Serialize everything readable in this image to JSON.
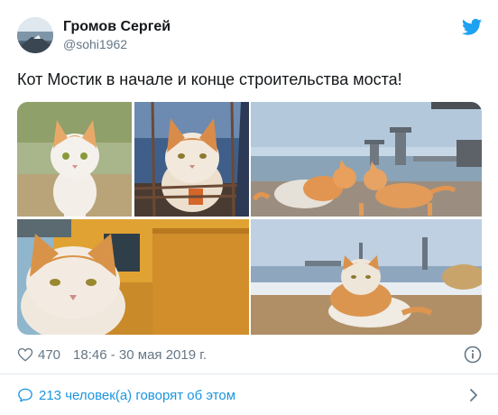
{
  "author": {
    "name": "Громов Сергей",
    "handle": "@sohi1962"
  },
  "tweet": {
    "text": "Кот Мостик в начале и конце строительства моста!",
    "likes": "470",
    "timestamp": "18:46 - 30 мая 2019 г.",
    "conversation_label": "213 человек(а) говорят об этом"
  },
  "icons": {
    "brand": "twitter-bird-icon",
    "like": "heart-icon",
    "info": "info-icon",
    "reply": "speech-bubble-icon",
    "more": "chevron-right-icon"
  },
  "colors": {
    "twitter_blue": "#1da1f2",
    "link_blue": "#1b95e0",
    "muted": "#657786",
    "text": "#14171a"
  }
}
